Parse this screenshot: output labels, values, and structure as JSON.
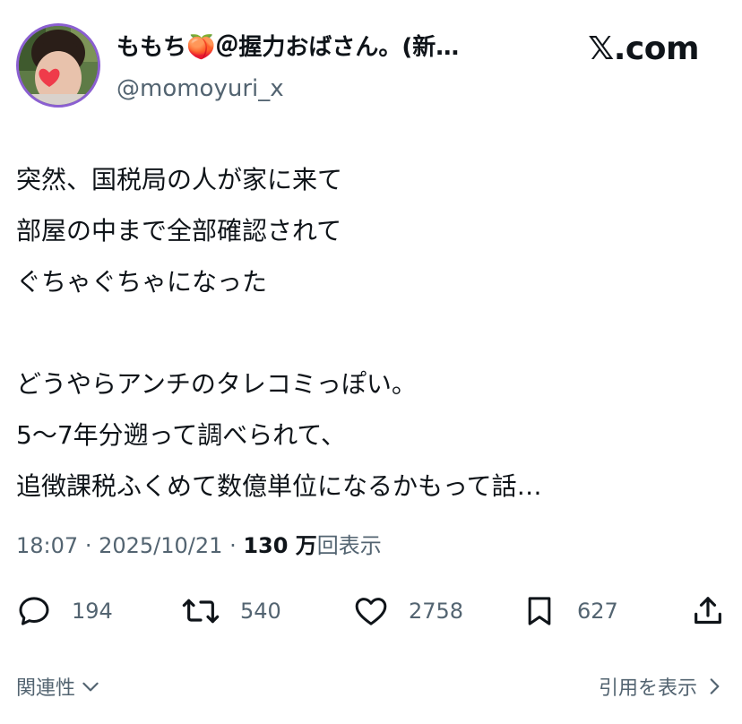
{
  "author": {
    "display_name": "ももち🍑＠握力おばさん。(新…",
    "handle": "@momoyuri_x",
    "avatar_icon": "profile-photo-with-heart-sticker"
  },
  "brand": "𝕏.com",
  "tweet": {
    "lines": [
      "突然、国税局の人が家に来て",
      "部屋の中まで全部確認されて",
      "ぐちゃぐちゃになった",
      "",
      "どうやらアンチのタレコミっぽい。",
      "5〜7年分遡って調べられて、",
      "追徴課税ふくめて数億単位になるかもって話…"
    ]
  },
  "meta": {
    "time": "18:07",
    "date": "2025/10/21",
    "separator": "·",
    "views_count": "130 万",
    "views_label": "回表示"
  },
  "actions": {
    "replies": "194",
    "reposts": "540",
    "likes": "2758",
    "bookmarks": "627"
  },
  "footer": {
    "related_label": "関連性",
    "quotes_label": "引用を表示"
  },
  "colors": {
    "text": "#0f1419",
    "secondary": "#536471",
    "avatar_ring": "#8b5fd1"
  }
}
